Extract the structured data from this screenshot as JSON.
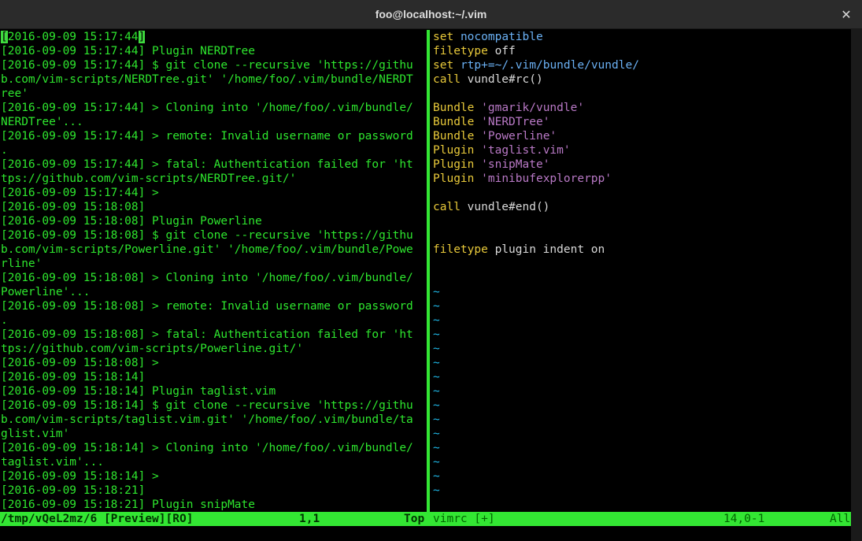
{
  "window": {
    "title": "foo@localhost:~/.vim",
    "close_glyph": "✕"
  },
  "left_pane": {
    "cursor_char": "[",
    "first_line_rest": "2016-09-09 15:17:44",
    "first_line_end_cursor": "]",
    "lines": [
      "[2016-09-09 15:17:44] Plugin NERDTree",
      "[2016-09-09 15:17:44] $ git clone --recursive 'https://githu",
      "b.com/vim-scripts/NERDTree.git' '/home/foo/.vim/bundle/NERDT",
      "ree'",
      "[2016-09-09 15:17:44] > Cloning into '/home/foo/.vim/bundle/",
      "NERDTree'...",
      "[2016-09-09 15:17:44] > remote: Invalid username or password",
      ".",
      "[2016-09-09 15:17:44] > fatal: Authentication failed for 'ht",
      "tps://github.com/vim-scripts/NERDTree.git/'",
      "[2016-09-09 15:17:44] >",
      "[2016-09-09 15:18:08]",
      "[2016-09-09 15:18:08] Plugin Powerline",
      "[2016-09-09 15:18:08] $ git clone --recursive 'https://githu",
      "b.com/vim-scripts/Powerline.git' '/home/foo/.vim/bundle/Powe",
      "rline'",
      "[2016-09-09 15:18:08] > Cloning into '/home/foo/.vim/bundle/",
      "Powerline'...",
      "[2016-09-09 15:18:08] > remote: Invalid username or password",
      ".",
      "[2016-09-09 15:18:08] > fatal: Authentication failed for 'ht",
      "tps://github.com/vim-scripts/Powerline.git/'",
      "[2016-09-09 15:18:08] >",
      "[2016-09-09 15:18:14]",
      "[2016-09-09 15:18:14] Plugin taglist.vim",
      "[2016-09-09 15:18:14] $ git clone --recursive 'https://githu",
      "b.com/vim-scripts/taglist.vim.git' '/home/foo/.vim/bundle/ta",
      "glist.vim'",
      "[2016-09-09 15:18:14] > Cloning into '/home/foo/.vim/bundle/",
      "taglist.vim'...",
      "[2016-09-09 15:18:14] >",
      "[2016-09-09 15:18:21]",
      "[2016-09-09 15:18:21] Plugin snipMate"
    ]
  },
  "right_pane": {
    "lines": [
      [
        {
          "t": "set",
          "c": "kw"
        },
        {
          "t": " "
        },
        {
          "t": "nocompatible",
          "c": "id"
        }
      ],
      [
        {
          "t": "filetype",
          "c": "kw"
        },
        {
          "t": " "
        },
        {
          "t": "off",
          "c": "fn"
        }
      ],
      [
        {
          "t": "set",
          "c": "kw"
        },
        {
          "t": " "
        },
        {
          "t": "rtp",
          "c": "id"
        },
        {
          "t": "+=~/.vim/bundle/vundle/",
          "c": "id"
        }
      ],
      [
        {
          "t": "call",
          "c": "kw"
        },
        {
          "t": " vundle#rc()",
          "c": "fn"
        }
      ],
      [],
      [
        {
          "t": "Bundle",
          "c": "kw"
        },
        {
          "t": " "
        },
        {
          "t": "'gmarik/vundle'",
          "c": "str"
        }
      ],
      [
        {
          "t": "Bundle",
          "c": "kw"
        },
        {
          "t": " "
        },
        {
          "t": "'NERDTree'",
          "c": "str"
        }
      ],
      [
        {
          "t": "Bundle",
          "c": "kw"
        },
        {
          "t": " "
        },
        {
          "t": "'Powerline'",
          "c": "str"
        }
      ],
      [
        {
          "t": "Plugin",
          "c": "kw"
        },
        {
          "t": " "
        },
        {
          "t": "'taglist.vim'",
          "c": "str"
        }
      ],
      [
        {
          "t": "Plugin",
          "c": "kw"
        },
        {
          "t": " "
        },
        {
          "t": "'snipMate'",
          "c": "str"
        }
      ],
      [
        {
          "t": "Plugin",
          "c": "kw"
        },
        {
          "t": " "
        },
        {
          "t": "'minibufexplorerpp'",
          "c": "str"
        }
      ],
      [],
      [
        {
          "t": "call",
          "c": "kw"
        },
        {
          "t": " vundle#end()",
          "c": "fn"
        }
      ],
      [],
      [],
      [
        {
          "t": "filetype",
          "c": "kw"
        },
        {
          "t": " plugin indent on",
          "c": "fn"
        }
      ],
      [],
      [],
      [
        {
          "t": "~",
          "c": "tilde"
        }
      ],
      [
        {
          "t": "~",
          "c": "tilde"
        }
      ],
      [
        {
          "t": "~",
          "c": "tilde"
        }
      ],
      [
        {
          "t": "~",
          "c": "tilde"
        }
      ],
      [
        {
          "t": "~",
          "c": "tilde"
        }
      ],
      [
        {
          "t": "~",
          "c": "tilde"
        }
      ],
      [
        {
          "t": "~",
          "c": "tilde"
        }
      ],
      [
        {
          "t": "~",
          "c": "tilde"
        }
      ],
      [
        {
          "t": "~",
          "c": "tilde"
        }
      ],
      [
        {
          "t": "~",
          "c": "tilde"
        }
      ],
      [
        {
          "t": "~",
          "c": "tilde"
        }
      ],
      [
        {
          "t": "~",
          "c": "tilde"
        }
      ],
      [
        {
          "t": "~",
          "c": "tilde"
        }
      ],
      [
        {
          "t": "~",
          "c": "tilde"
        }
      ],
      [
        {
          "t": "~",
          "c": "tilde"
        }
      ]
    ]
  },
  "status_left": {
    "file": "/tmp/vQeL2mz/6 [Preview][RO]",
    "position": "1,1",
    "scroll": "Top"
  },
  "status_right": {
    "file": "vimrc [+]",
    "position": "14,0-1",
    "scroll": "All"
  },
  "colors": {
    "terminal_bg": "#000000",
    "output_green": "#2ee62e",
    "statusline_green": "#33e633",
    "keyword_yellow": "#e8c93a",
    "identifier_blue": "#6ab0f3",
    "string_purple": "#b979c6",
    "tilde_cyan": "#1fb8e8"
  }
}
